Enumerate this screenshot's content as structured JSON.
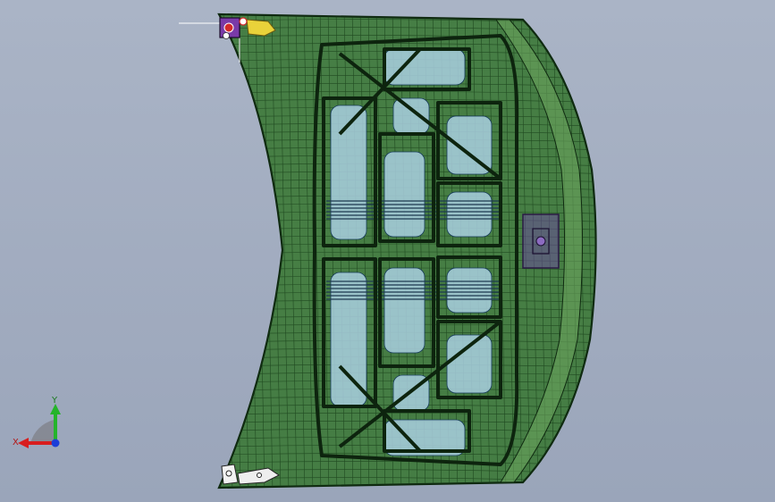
{
  "viewport": {
    "background_top": "#aab4c6",
    "background_bottom": "#9aa5ba"
  },
  "model": {
    "part": "hood-inner-panel",
    "view": "wireframe-shaded",
    "colors": {
      "shell_fill": "#3e7a3a",
      "shell_edge": "#0f2a10",
      "wire": "#153a16",
      "recess_fill": "#a9cfe0",
      "highlight_fill": "#5f9c55",
      "bracket_purple": "#6a4a9a",
      "hinge_yellow": "#e9d23a",
      "hinge_red": "#c23a3a"
    }
  },
  "triad": {
    "y_label": "Y",
    "x_label": "X",
    "colors": {
      "x": "#d81e1e",
      "y": "#25b42a",
      "z": "#1c3ed8"
    }
  }
}
